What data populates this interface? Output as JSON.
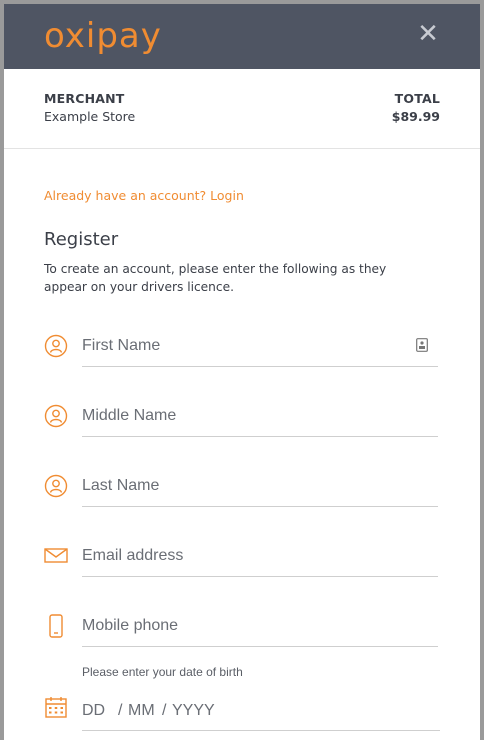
{
  "brand": {
    "name": "oxipay",
    "accent": "#f08c32",
    "header_bg": "#4f5563"
  },
  "header": {
    "close_icon": "close-icon"
  },
  "summary": {
    "merchant_label": "MERCHANT",
    "merchant_value": "Example Store",
    "total_label": "TOTAL",
    "total_value": "$89.99"
  },
  "login_link": "Already have an account? Login",
  "register": {
    "title": "Register",
    "subtitle": "To create an account, please enter the following as they appear on your drivers licence."
  },
  "fields": {
    "first_name": {
      "placeholder": "First Name",
      "icon": "user-icon"
    },
    "middle_name": {
      "placeholder": "Middle Name",
      "icon": "user-icon"
    },
    "last_name": {
      "placeholder": "Last Name",
      "icon": "user-icon"
    },
    "email": {
      "placeholder": "Email address",
      "icon": "envelope-icon"
    },
    "mobile": {
      "placeholder": "Mobile phone",
      "icon": "phone-icon"
    }
  },
  "dob": {
    "note": "Please enter your date of birth",
    "day": "DD",
    "sep1": "/",
    "month": "MM",
    "sep2": "/",
    "year": "YYYY",
    "icon": "calendar-icon"
  }
}
